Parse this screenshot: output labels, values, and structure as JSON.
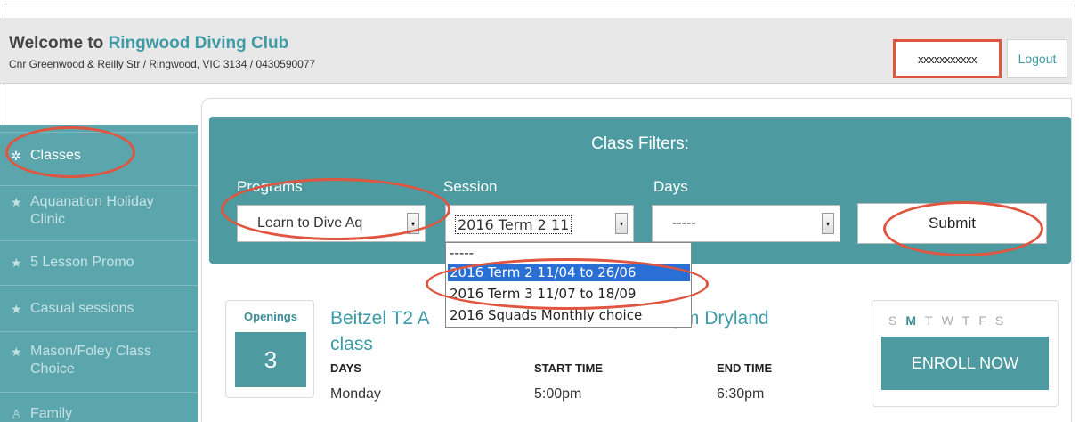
{
  "header": {
    "welcome_prefix": "Welcome to",
    "club_name": "Ringwood Diving Club",
    "address": "Cnr Greenwood & Reilly Str / Ringwood, VIC 3134 / 0430590077",
    "username": "xxxxxxxxxxx",
    "logout_label": "Logout"
  },
  "sidebar": {
    "items": [
      {
        "icon": "people-icon",
        "label": "Classes",
        "active": true
      },
      {
        "icon": "star-icon",
        "label": "Aquanation Holiday Clinic"
      },
      {
        "icon": "star-icon",
        "label": "5 Lesson Promo"
      },
      {
        "icon": "star-icon",
        "label": "Casual sessions"
      },
      {
        "icon": "star-icon",
        "label": "Mason/Foley Class Choice"
      },
      {
        "icon": "family-icon",
        "label": "Family"
      }
    ]
  },
  "filters": {
    "title": "Class Filters:",
    "programs_label": "Programs",
    "programs_value": "Learn to Dive Aq",
    "session_label": "Session",
    "session_value": "2016 Term 2 11",
    "days_label": "Days",
    "days_value": "-----",
    "submit_label": "Submit",
    "session_options": [
      "-----",
      "2016 Term 2 11/04 to 26/06",
      "2016 Term 3 11/07 to 18/09",
      "2016 Squads Monthly choice"
    ],
    "selected_option_index": 1
  },
  "class_card": {
    "openings_label": "Openings",
    "openings_count": "3",
    "title_left": "Beitzel T2 A",
    "title_right": "pm Dryland",
    "title_line2": "class",
    "days_header": "DAYS",
    "start_header": "START TIME",
    "end_header": "END TIME",
    "day_value": "Monday",
    "start_value": "5:00pm",
    "end_value": "6:30pm"
  },
  "enroll": {
    "days": [
      "S",
      "M",
      "T",
      "W",
      "T",
      "F",
      "S"
    ],
    "active_day_index": 1,
    "button_label": "ENROLL NOW"
  },
  "colors": {
    "accent": "#4e9aa1",
    "link": "#3d9aa6",
    "annotation": "#e0553f",
    "dropdown_selected": "#2a6fd6"
  }
}
